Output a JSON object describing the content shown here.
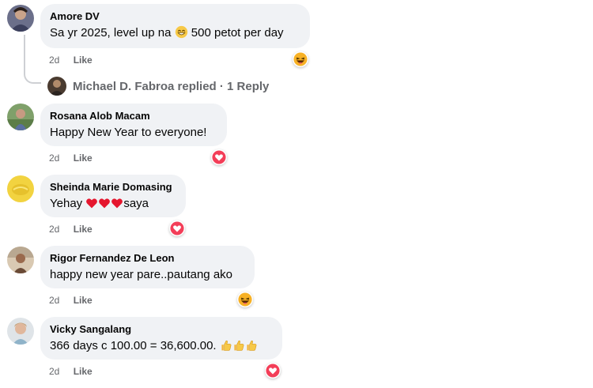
{
  "like_label": "Like",
  "comments": [
    {
      "author": "Amore DV",
      "text_before": "Sa yr 2025, level up na ",
      "emoji": "grin-emoji",
      "text_after": " 500 petot per day",
      "time": "2d",
      "reaction": "haha"
    },
    {
      "author": "Rosana Alob Macam",
      "text": "Happy New Year to everyone!",
      "time": "2d",
      "reaction": "love"
    },
    {
      "author": "Sheinda Marie Domasing",
      "text_before": "Yehay ",
      "text_after": "saya",
      "time": "2d",
      "reaction": "love"
    },
    {
      "author": "Rigor Fernandez De Leon",
      "text": "happy new year pare..pautang ako",
      "time": "2d",
      "reaction": "haha"
    },
    {
      "author": "Vicky Sangalang",
      "text": "366 days c 100.00 = 36,600.00. ",
      "time": "2d",
      "reaction": "love"
    }
  ],
  "reply": {
    "text": "Michael D. Fabroa replied · 1 Reply"
  },
  "colors": {
    "bubble": "#f0f2f5",
    "love": "#f33e58",
    "haha": "#f7b125",
    "meta": "#65676b"
  }
}
